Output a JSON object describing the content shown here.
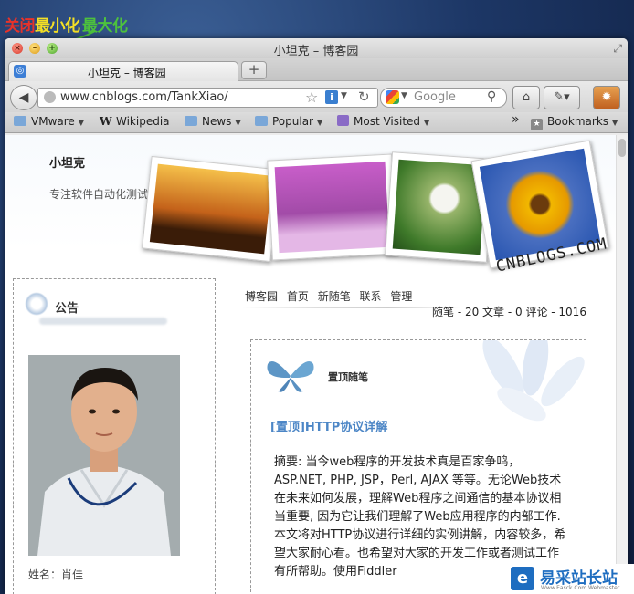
{
  "annotations": {
    "close": "关闭",
    "minimize": "最小化",
    "maximize": "最大化"
  },
  "window": {
    "title": "小坦克 – 博客园"
  },
  "tabs": [
    {
      "title": "小坦克 – 博客园"
    }
  ],
  "toolbar": {
    "url": "www.cnblogs.com/TankXiao/",
    "search_placeholder": "Google",
    "bookmarks": [
      {
        "label": "VMware",
        "icon": "folder-icon",
        "dropdown": true
      },
      {
        "label": "Wikipedia",
        "icon": "wikipedia-icon",
        "dropdown": false
      },
      {
        "label": "News",
        "icon": "folder-icon",
        "dropdown": true
      },
      {
        "label": "Popular",
        "icon": "folder-icon",
        "dropdown": true
      },
      {
        "label": "Most Visited",
        "icon": "most-visited-icon",
        "dropdown": true
      }
    ],
    "overflow": "»",
    "bookmarks_menu": "Bookmarks"
  },
  "blog": {
    "title": "小坦克",
    "subtitle": "专注软件自动化测试。努力学习开发技术，用到测试工作上。",
    "logo_text": "CNBLOGS.COM",
    "nav": [
      "博客园",
      "首页",
      "新随笔",
      "联系",
      "管理"
    ],
    "stats": "随笔 - 20  文章 - 0  评论 - 1016"
  },
  "sidebar": {
    "title": "公告",
    "name_label": "姓名：肖佳"
  },
  "post": {
    "section": "置顶随笔",
    "title": "[置顶]HTTP协议详解",
    "body": "摘要: 当今web程序的开发技术真是百家争鸣，ASP.NET, PHP, JSP，Perl, AJAX 等等。无论Web技术在未来如何发展，理解Web程序之间通信的基本协议相当重要, 因为它让我们理解了Web应用程序的内部工作. 本文将对HTTP协议进行详细的实例讲解，内容较多，希望大家耐心看。也希望对大家的开发工作或者测试工作有所帮助。使用Fiddler"
  },
  "watermark": {
    "text": "易采站长站",
    "small": "Www.Easck.Com Webmaster"
  }
}
